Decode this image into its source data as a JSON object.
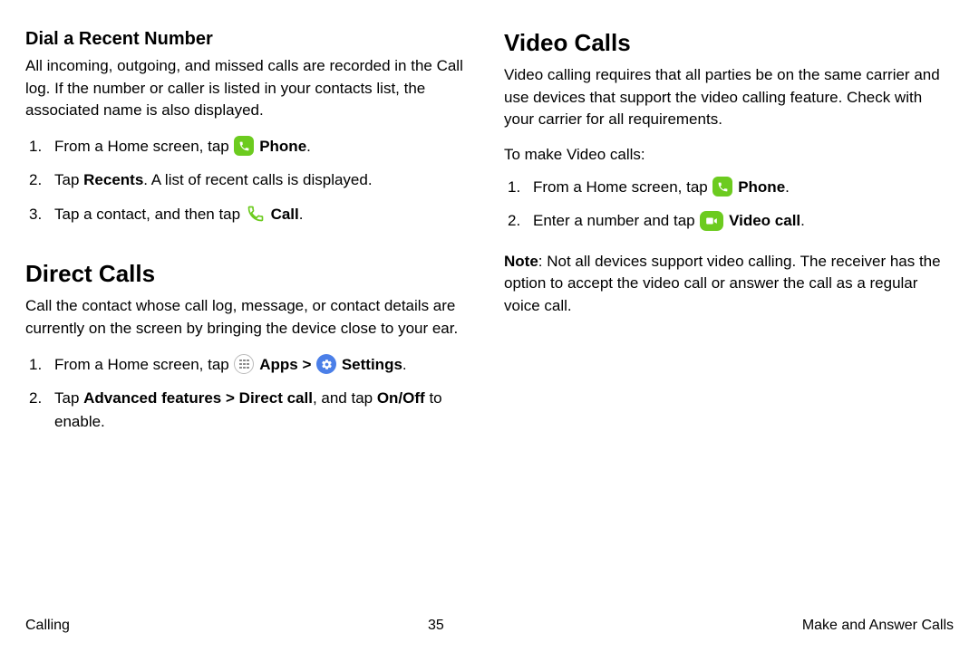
{
  "left": {
    "h1": "Dial a Recent Number",
    "p1": "All incoming, outgoing, and missed calls are recorded in the Call log. If the number or caller is listed in your contacts list, the associated name is also displayed.",
    "step1_pre": "From a Home screen, tap ",
    "phone_label": "Phone",
    "step2_pre": "Tap ",
    "step2_bold": "Recents",
    "step2_post": ". A list of recent calls is displayed.",
    "step3_pre": "Tap a contact, and then tap ",
    "call_label": "Call",
    "h2": "Direct Calls",
    "p2": "Call the contact whose call log, message, or contact details are currently on the screen by bringing the device close to your ear.",
    "dc_step1_pre": "From a Home screen, tap ",
    "apps_label": "Apps",
    "settings_label": "Settings",
    "dc_step2_pre": "Tap ",
    "dc_step2_b1": "Advanced features",
    "dc_step2_b2": "Direct call",
    "dc_step2_mid": ", and tap ",
    "dc_step2_b3": "On/Off",
    "dc_step2_post": " to enable."
  },
  "right": {
    "h1": "Video Calls",
    "p1": "Video calling requires that all parties be on the same carrier and use devices that support the video calling feature. Check with your carrier for all requirements.",
    "p2": "To make Video calls:",
    "step1_pre": "From a Home screen, tap ",
    "phone_label": "Phone",
    "step2_pre": "Enter a number and tap ",
    "video_label": "Video call",
    "note_label": "Note",
    "note_body": ": Not all devices support video calling. The receiver has the option to accept the video call or answer the call as a regular voice call."
  },
  "footer": {
    "left": "Calling",
    "center": "35",
    "right": "Make and Answer Calls"
  },
  "glyphs": {
    "chevron": ">"
  }
}
